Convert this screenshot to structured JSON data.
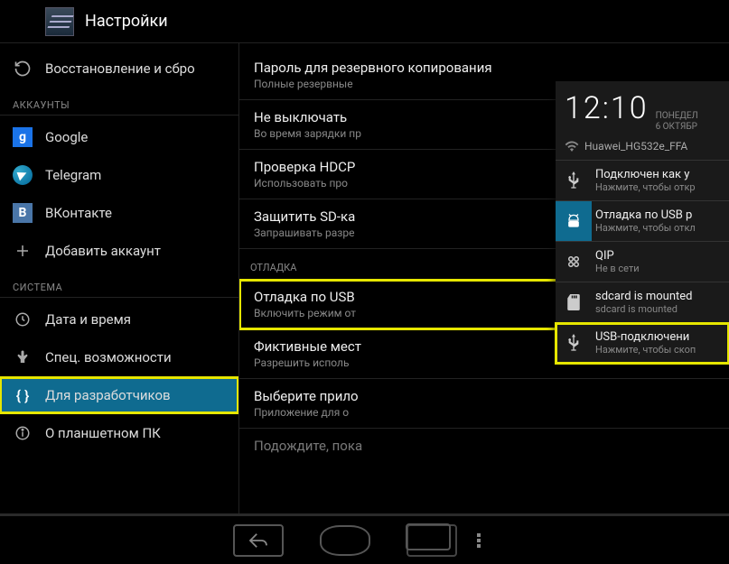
{
  "appTitle": "Настройки",
  "sidebar": {
    "backup": "Восстановление и сбро",
    "accountsHeader": "АККАУНТЫ",
    "google": "Google",
    "telegram": "Telegram",
    "vk": "ВКонтакте",
    "addAccount": "Добавить аккаунт",
    "systemHeader": "СИСТЕМА",
    "dateTime": "Дата и время",
    "accessibility": "Спец. возможности",
    "developer": "Для разработчиков",
    "about": "О планшетном ПК"
  },
  "main": {
    "i1t": "Пароль для резервного копирования",
    "i1s": "Полные резервные",
    "i2t": "Не выключать",
    "i2s": "Во время зарядки пр",
    "i3t": "Проверка HDCP",
    "i3s": "Использовать про",
    "i4t": "Защитить SD-ка",
    "i4s": "Запрашивать разре",
    "section": "ОТЛАДКА",
    "i5t": "Отладка по USB",
    "i5s": "Включить режим от",
    "i6t": "Фиктивные мест",
    "i6s": "Разрешить исполь",
    "i7t": "Выберите прило",
    "i7s": "Приложение для о",
    "i8t": "Подождите, пока"
  },
  "shade": {
    "time": "12:10",
    "day": "ПОНЕДЕЛ",
    "date": "6 ОКТЯБР",
    "wifi": "Huawei_HG532e_FFA",
    "n1t": "Подключен как у",
    "n1s": "Нажмите, чтобы откр",
    "n2t": "Отладка по USB р",
    "n2s": "Нажмите, чтобы откл",
    "n3t": "QIP",
    "n3s": "Не в сети",
    "n4t": "sdcard is mounted",
    "n4s": "sdcard is mounted",
    "n5t": "USB-подключени",
    "n5s": "Нажмите, чтобы скоп"
  }
}
